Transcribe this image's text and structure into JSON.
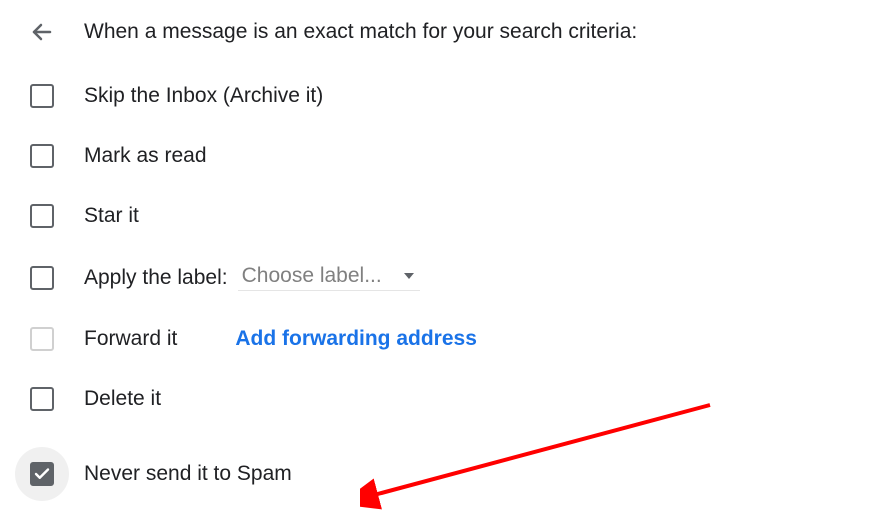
{
  "header": {
    "title": "When a message is an exact match for your search criteria:"
  },
  "options": {
    "skip_inbox": "Skip the Inbox (Archive it)",
    "mark_read": "Mark as read",
    "star": "Star it",
    "apply_label": "Apply the label:",
    "choose_label_placeholder": "Choose label...",
    "forward": "Forward it",
    "forward_link": "Add forwarding address",
    "delete": "Delete it",
    "never_spam": "Never send it to Spam"
  }
}
